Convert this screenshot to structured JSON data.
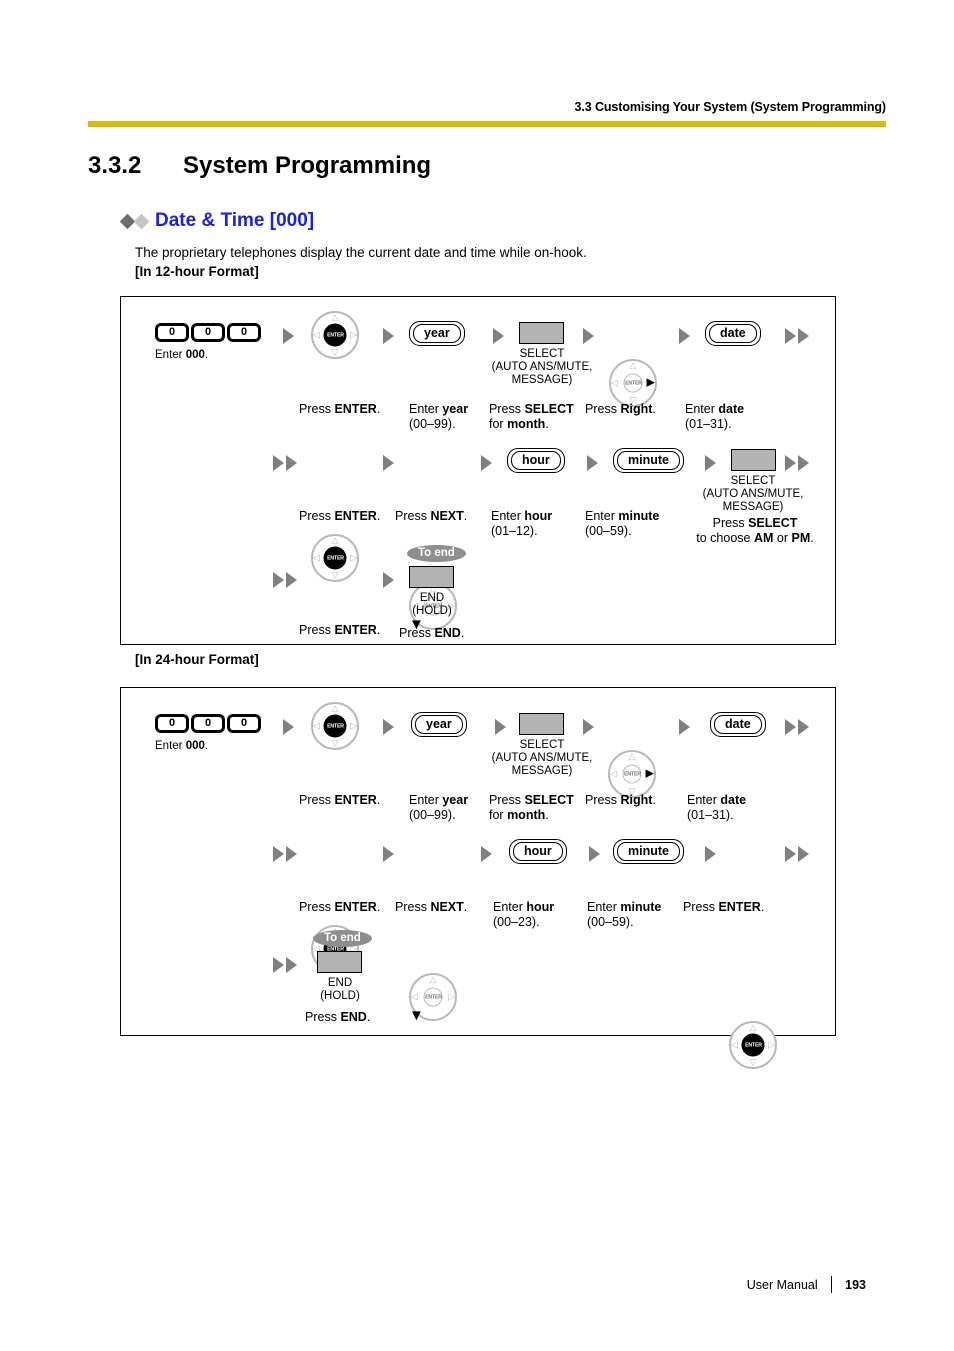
{
  "header": {
    "running_head": "3.3 Customising Your System (System Programming)"
  },
  "section": {
    "number": "3.3.2",
    "title": "System Programming"
  },
  "subsection": {
    "title": "Date & Time [000]",
    "intro": "The proprietary telephones display the current date and time while on-hook."
  },
  "format_labels": {
    "twelve": "[In 12-hour Format]",
    "twentyfour": "[In 24-hour Format]"
  },
  "common": {
    "zero": "0",
    "enter_glyph": "ENTER",
    "select_caption_line1": "SELECT",
    "select_caption_line2": "(AUTO ANS/MUTE,",
    "select_caption_line3": "MESSAGE)",
    "end_caption_line1": "END",
    "end_caption_line2": "(HOLD)",
    "to_end": "To end",
    "enter_000": "Enter 000.",
    "press_enter": "Press ENTER.",
    "press_next": "Press NEXT.",
    "press_right": "Press Right.",
    "press_end": "Press END.",
    "press_select_for_month_l1": "Press SELECT",
    "press_select_for_month_l2": "for month.",
    "enter_year_l1": "Enter year",
    "enter_year_l2": "(00–99).",
    "enter_date_l1": "Enter date",
    "enter_date_l2": "(01–31).",
    "enter_minute_l1": "Enter minute",
    "enter_minute_l2": "(00–59).",
    "pill_year": "year",
    "pill_hour": "hour",
    "pill_minute": "minute",
    "pill_date": "date"
  },
  "flow12": {
    "hour_range_l1": "Enter hour",
    "hour_range_l2": "(01–12).",
    "ampm_l1": "Press SELECT",
    "ampm_l2": "to choose AM or PM."
  },
  "flow24": {
    "hour_range_l1": "Enter hour",
    "hour_range_l2": "(00–23)."
  },
  "footer": {
    "manual_label": "User Manual",
    "page_number": "193"
  },
  "colors": {
    "rule": "#ddb709",
    "heading_blue": "#1a22de",
    "grey_key": "#b3b3b3",
    "arrow_grey": "#808080",
    "badge_grey": "#8e8e8e"
  }
}
